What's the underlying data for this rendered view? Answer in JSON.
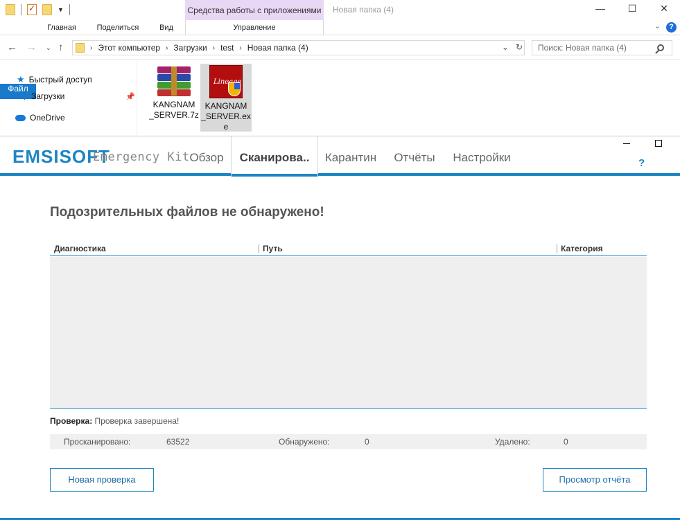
{
  "explorer": {
    "context_tab": "Средства работы с приложениями",
    "window_title": "Новая папка (4)",
    "controls": {
      "minimize": "—",
      "maximize": "☐",
      "close": "✕"
    },
    "ribbon": {
      "file": "Файл",
      "home": "Главная",
      "share": "Поделиться",
      "view": "Вид",
      "manage": "Управление",
      "help": "?"
    },
    "address": {
      "crumbs": [
        "Этот компьютер",
        "Загрузки",
        "test",
        "Новая папка (4)"
      ],
      "search_placeholder": "Поиск: Новая папка (4)"
    },
    "nav": {
      "quick_access": "Быстрый доступ",
      "downloads": "Загрузки",
      "onedrive": "OneDrive"
    },
    "files": [
      {
        "name_line1": "KANGNAM",
        "name_line2": "_SERVER.7z",
        "icon": "winrar-archive-icon",
        "selected": false
      },
      {
        "name_line1": "KANGNAM",
        "name_line2": "_SERVER.ex",
        "name_line3": "e",
        "icon": "lineage-exe-icon",
        "selected": true
      }
    ]
  },
  "emsisoft": {
    "logo": "EMSISOFT",
    "logo_sub": "Emergency Kit",
    "tabs": [
      "Обзор",
      "Сканирова..",
      "Карантин",
      "Отчёты",
      "Настройки"
    ],
    "active_tab": "Сканирова..",
    "help": "?",
    "result_title": "Подозрительных файлов не обнаружено!",
    "columns": [
      "Диагностика",
      "Путь",
      "Категория"
    ],
    "status_label": "Проверка:",
    "status_value": "Проверка завершена!",
    "stats": {
      "scanned_label": "Просканировано:",
      "scanned_value": "63522",
      "found_label": "Обнаружено:",
      "found_value": "0",
      "removed_label": "Удалено:",
      "removed_value": "0"
    },
    "buttons": {
      "new_scan": "Новая проверка",
      "view_report": "Просмотр отчёта"
    },
    "brand_color": "#1d85c4"
  }
}
